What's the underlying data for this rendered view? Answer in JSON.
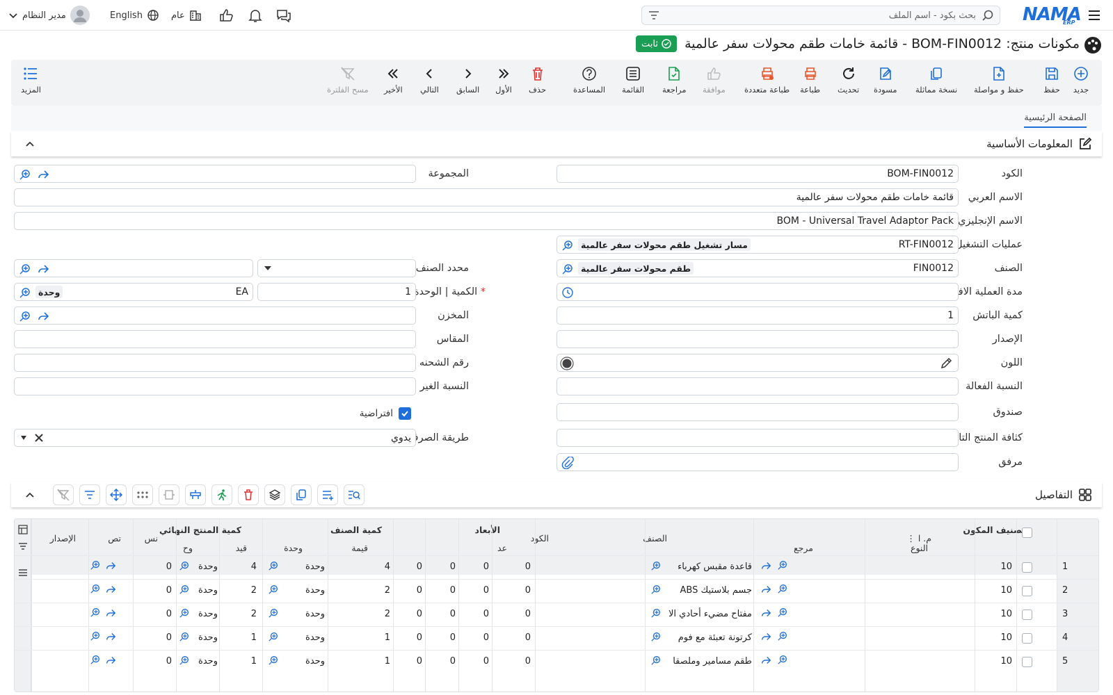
{
  "topbar": {
    "search_placeholder": "بحث بكود - اسم الملف",
    "language": "English",
    "branch": "عام",
    "user": "مدير النظام",
    "logo": "NAMA",
    "logo_sub": "ERP"
  },
  "page": {
    "title": "مكونات منتج: BOM-FIN0012 - قائمة خامات طقم محولات سفر عالمية",
    "status": "ثابت"
  },
  "toolbar": {
    "new": "جديد",
    "save": "حفظ",
    "save_continue": "حفظ و مواصلة",
    "duplicate": "نسخة مماثلة",
    "draft": "مسودة",
    "refresh": "تحديث",
    "print": "طباعة",
    "multi_print": "طباعة متعددة",
    "approve": "موافقة",
    "review": "مراجعة",
    "list": "القائمة",
    "help": "المساعدة",
    "delete": "حذف",
    "first": "الأول",
    "previous": "السابق",
    "next": "التالي",
    "last": "الأخير",
    "clear_filter": "مسح الفلترة",
    "more": "المزيد"
  },
  "tabs": {
    "main": "الصفحة الرئيسية"
  },
  "basic": {
    "title": "المعلومات الأساسية",
    "code_label": "الكود",
    "code": "BOM-FIN0012",
    "group_label": "المجموعة",
    "arabic_name_label": "الاسم العربي",
    "arabic_name": "قائمة خامات طقم محولات سفر عالمية",
    "english_name_label": "الاسم الإنجليزي",
    "english_name": "BOM - Universal Travel Adaptor Pack",
    "operations_label": "عمليات التشغيل",
    "operations_code": "RT-FIN0012",
    "operations_name": "مسار تشغيل طقم محولات سفر عالمية",
    "item_label": "الصنف",
    "item_code": "FIN0012",
    "item_name": "طقم محولات سفر عالمية",
    "item_specifier_label": "محدد الصنف",
    "qty_unit_label": "الكمية | الوحدة",
    "qty": "1",
    "unit_code": "EA",
    "unit_name": "وحدة",
    "default_duration_label": "مدة العملية الافتراضية",
    "warehouse_label": "المخزن",
    "batch_qty_label": "كمية الباتش",
    "batch_qty": "1",
    "version_label": "الإصدار",
    "size_label": "المقاس",
    "color_label": "اللون",
    "lot_label": "رقم الشحنه",
    "effective_ratio_label": "النسبة الفعالة",
    "inactive_ratio_label": "النسبة الغير فعالة",
    "box_label": "صندوق",
    "default_label": "افتراضية",
    "density_label": "كثافة المنتج التام",
    "issue_method_label": "طريقة الصرف",
    "issue_method": "يدوي",
    "attachment_label": "مرفق"
  },
  "details": {
    "title": "التفاصيل",
    "headers": {
      "seq": "م. ا",
      "component_class": "تصنيف المكون",
      "type": "النوع",
      "reference": "مرجع",
      "item": "الصنف",
      "code": "الكود",
      "dimensions": "الأبعاد",
      "count": "عد",
      "item_qty": "كمية الصنف",
      "value": "قيمة",
      "unit": "وحدة",
      "final_qty": "كمية المنتج النهائي",
      "entry": "قيد",
      "unit_short": "وح",
      "ratio": "نس",
      "class_short": "تص",
      "version": "الإصدار"
    },
    "rows": [
      {
        "n": "1",
        "seq": "10",
        "item": "قاعدة مقبس كهرباء",
        "dim": "0",
        "d1": "0",
        "d2": "0",
        "d3": "0",
        "value": "4",
        "unit": "وحدة",
        "entry": "4",
        "funit": "وحدة",
        "ratio": "0"
      },
      {
        "n": "2",
        "seq": "10",
        "item": "جسم بلاستيك ABS",
        "dim": "0",
        "d1": "0",
        "d2": "0",
        "d3": "0",
        "value": "2",
        "unit": "وحدة",
        "entry": "2",
        "funit": "وحدة",
        "ratio": "0"
      },
      {
        "n": "3",
        "seq": "10",
        "item": "مفتاح مضيء أحادي الا",
        "dim": "0",
        "d1": "0",
        "d2": "0",
        "d3": "0",
        "value": "2",
        "unit": "وحدة",
        "entry": "2",
        "funit": "وحدة",
        "ratio": "0"
      },
      {
        "n": "4",
        "seq": "10",
        "item": "كرتونة تعبئة مع فوم",
        "dim": "0",
        "d1": "0",
        "d2": "0",
        "d3": "0",
        "value": "1",
        "unit": "وحدة",
        "entry": "1",
        "funit": "وحدة",
        "ratio": "0"
      },
      {
        "n": "5",
        "seq": "10",
        "item": "طقم مسامير وملصقا",
        "dim": "0",
        "d1": "0",
        "d2": "0",
        "d3": "0",
        "value": "1",
        "unit": "وحدة",
        "entry": "1",
        "funit": "وحدة",
        "ratio": "0"
      }
    ]
  }
}
